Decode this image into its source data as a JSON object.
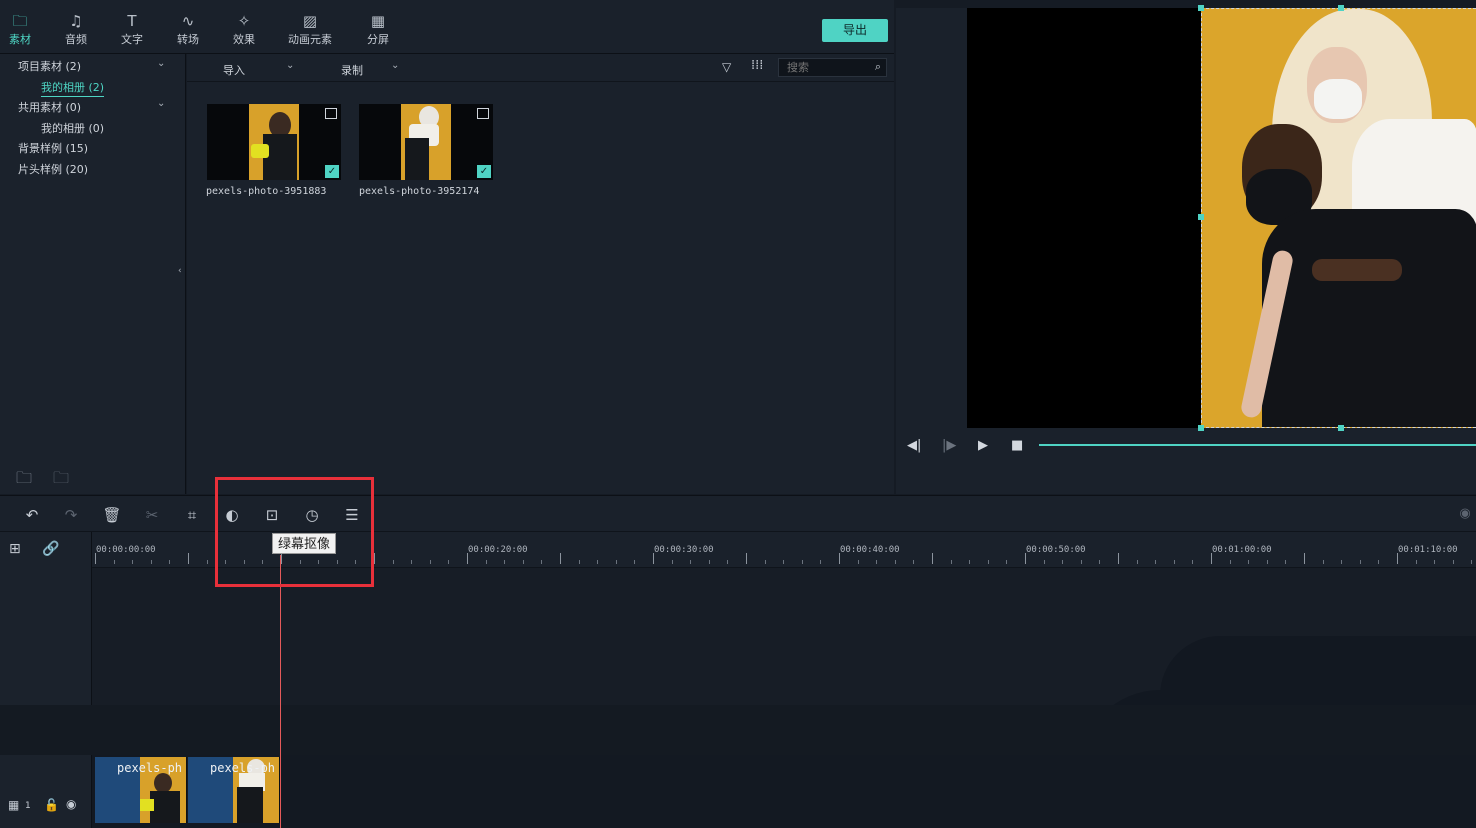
{
  "tabs": [
    {
      "label": "素材",
      "icon": "folder-icon",
      "glyph": "🗀",
      "active": true
    },
    {
      "label": "音频",
      "icon": "music-icon",
      "glyph": "♫",
      "active": false
    },
    {
      "label": "文字",
      "icon": "text-icon",
      "glyph": "T",
      "active": false
    },
    {
      "label": "转场",
      "icon": "transition-icon",
      "glyph": "∿",
      "active": false
    },
    {
      "label": "效果",
      "icon": "effects-icon",
      "glyph": "✧",
      "active": false
    },
    {
      "label": "动画元素",
      "icon": "elements-icon",
      "glyph": "▨",
      "active": false
    },
    {
      "label": "分屏",
      "icon": "split-screen-icon",
      "glyph": "▦",
      "active": false
    }
  ],
  "export_label": "导出",
  "sidebar": {
    "items": [
      {
        "label": "项目素材 (2)"
      },
      {
        "label": "我的相册 (2)"
      },
      {
        "label": "共用素材 (0)"
      },
      {
        "label": "我的相册 (0)"
      },
      {
        "label": "背景样例 (15)"
      },
      {
        "label": "片头样例 (20)"
      }
    ]
  },
  "media_toolbar": {
    "import_label": "导入",
    "record_label": "录制",
    "search_placeholder": "搜索"
  },
  "media_items": [
    {
      "name": "pexels-photo-3951883"
    },
    {
      "name": "pexels-photo-3952174"
    }
  ],
  "tooltip": "绿幕抠像",
  "timecodes": [
    "00:00:00:00",
    "00:00:20:00",
    "00:00:30:00",
    "00:00:40:00",
    "00:00:50:00",
    "00:01:00:00",
    "00:01:10:00"
  ],
  "clips": [
    {
      "label": "pexels-ph"
    },
    {
      "label": "pexels-ph"
    }
  ],
  "track_number": "1",
  "colors": {
    "accent": "#4fd3c4",
    "highlight": "#e8303a",
    "playhead": "#e45a5a",
    "background": "#151b24"
  }
}
